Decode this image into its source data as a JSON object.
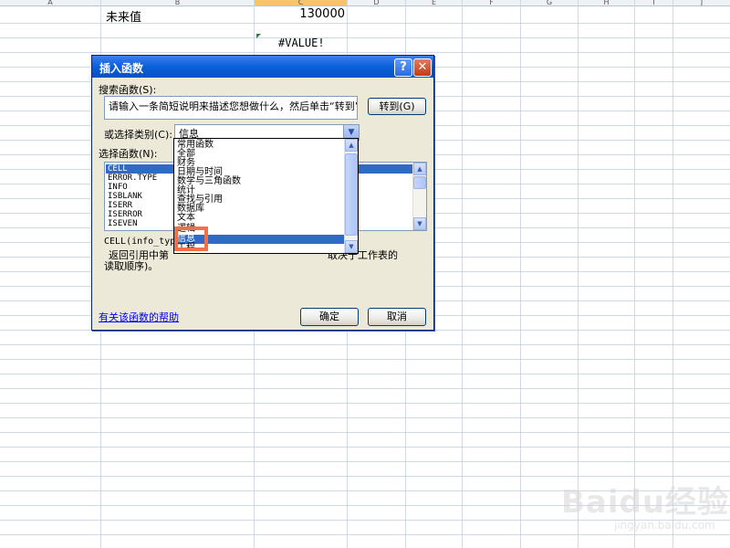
{
  "sheet": {
    "col_headers": [
      "A",
      "B",
      "C",
      "D",
      "E",
      "F",
      "G",
      "H",
      "I",
      "J"
    ],
    "active_column": "C",
    "row1_label": "未来值",
    "row1_value": "130000",
    "row3_value": "#VALUE!"
  },
  "dialog": {
    "title": "插入函数",
    "help_button": "?",
    "close_button": "✕",
    "search_label": "搜索函数(S):",
    "search_text": "请输入一条简短说明来描述您想做什么，然后单击“转到”",
    "goto_button": "转到(G)",
    "category_label": "或选择类别(C):",
    "category_value": "信息",
    "function_list_label": "选择函数(N):",
    "functions": [
      "CELL",
      "ERROR.TYPE",
      "INFO",
      "ISBLANK",
      "ISERR",
      "ISERROR",
      "ISEVEN"
    ],
    "description_signature": "CELL(info_typ",
    "description_line1_left": "返回引用中第",
    "description_line1_right": "取决于工作表的",
    "description_line2": "读取顺序)。",
    "help_link": "有关该函数的帮助",
    "ok_button": "确定",
    "cancel_button": "取消"
  },
  "dropdown": {
    "items": [
      "常用函数",
      "全部",
      "财务",
      "日期与时间",
      "数学与三角函数",
      "统计",
      "查找与引用",
      "数据库",
      "文本",
      "逻辑",
      "信息",
      "工程"
    ],
    "selected": "信息"
  },
  "icons": {
    "dropdown_arrow": "chevron-down-icon",
    "scroll_up": "scroll-up-icon",
    "scroll_down": "scroll-down-icon"
  },
  "colors": {
    "titlebar": "#0a5fd8",
    "selection": "#316ac5",
    "highlight_box": "#f0704a",
    "active_column": "#f7c46c"
  },
  "watermark": {
    "main": "Baidu经验",
    "sub": "jingyan.baidu.com"
  }
}
